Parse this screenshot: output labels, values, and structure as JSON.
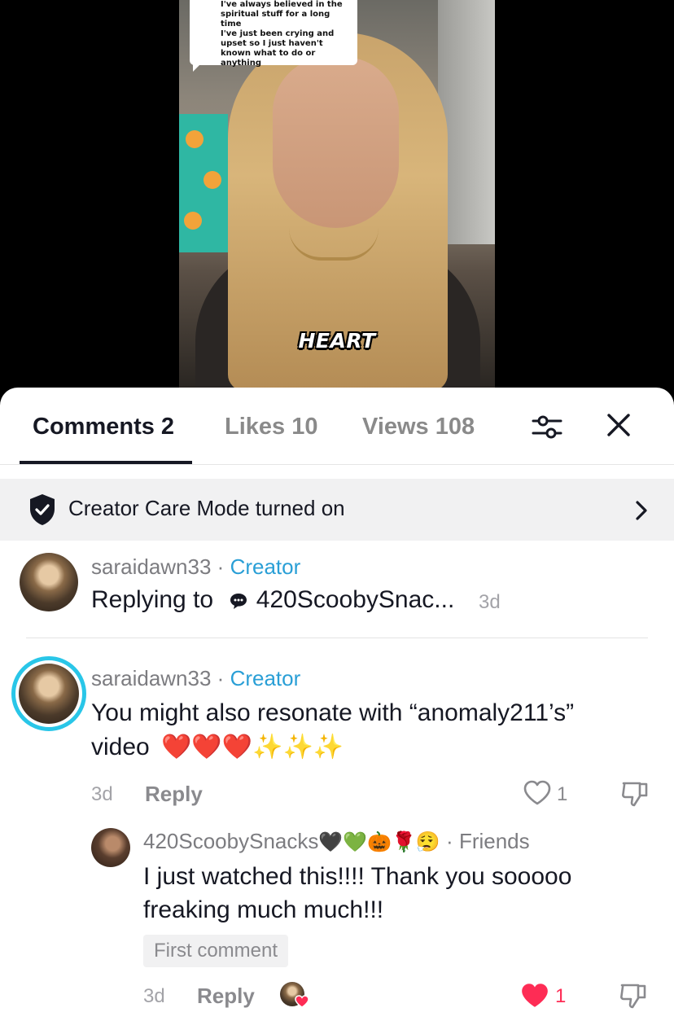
{
  "video": {
    "caption_text": "I've always believed in the\nspiritual stuff for a long time\nI've just been crying and\nupset so I just haven't\nknown what to do or\nanything",
    "overlay_word": "HEART"
  },
  "tabs": [
    {
      "label": "Comments 2",
      "active": true
    },
    {
      "label": "Likes 10",
      "active": false
    },
    {
      "label": "Views 108",
      "active": false
    }
  ],
  "icons": {
    "filter": "filter-sliders-icon",
    "close": "close-icon",
    "shield": "shield-check-icon",
    "chevron": "chevron-right-icon",
    "heart": "heart-icon",
    "dislike": "thumbs-down-icon",
    "comment_bubble": "comment-bubble-icon"
  },
  "care_mode": {
    "label": "Creator Care Mode turned on"
  },
  "comments": [
    {
      "username": "saraidawn33",
      "separator": "·",
      "tag": "Creator",
      "replying_prefix": "Replying to",
      "replying_to": "420ScoobySnac...",
      "time": "3d"
    },
    {
      "username": "saraidawn33",
      "separator": "·",
      "tag": "Creator",
      "text_line1": "You might also resonate with “anomaly211’s”",
      "text_line2": "video",
      "emoji_line": "❤️❤️❤️✨✨✨",
      "time": "3d",
      "reply_label": "Reply",
      "likes": "1"
    },
    {
      "username": "420ScoobySnacks",
      "username_emoji": "🖤💚🎃🌹😮‍💨",
      "separator": "·",
      "tag": "Friends",
      "text_line1": "I just watched this!!!! Thank you sooooo",
      "text_line2": "freaking much much!!!",
      "badge": "First comment",
      "time": "3d",
      "reply_label": "Reply",
      "likes": "1"
    }
  ],
  "colors": {
    "accent_blue": "#2a9fd6",
    "ring": "#29c6e8",
    "like_red": "#fe2c55",
    "heart_emoji": "#e3262f",
    "sparkle": "#f3c73c"
  }
}
